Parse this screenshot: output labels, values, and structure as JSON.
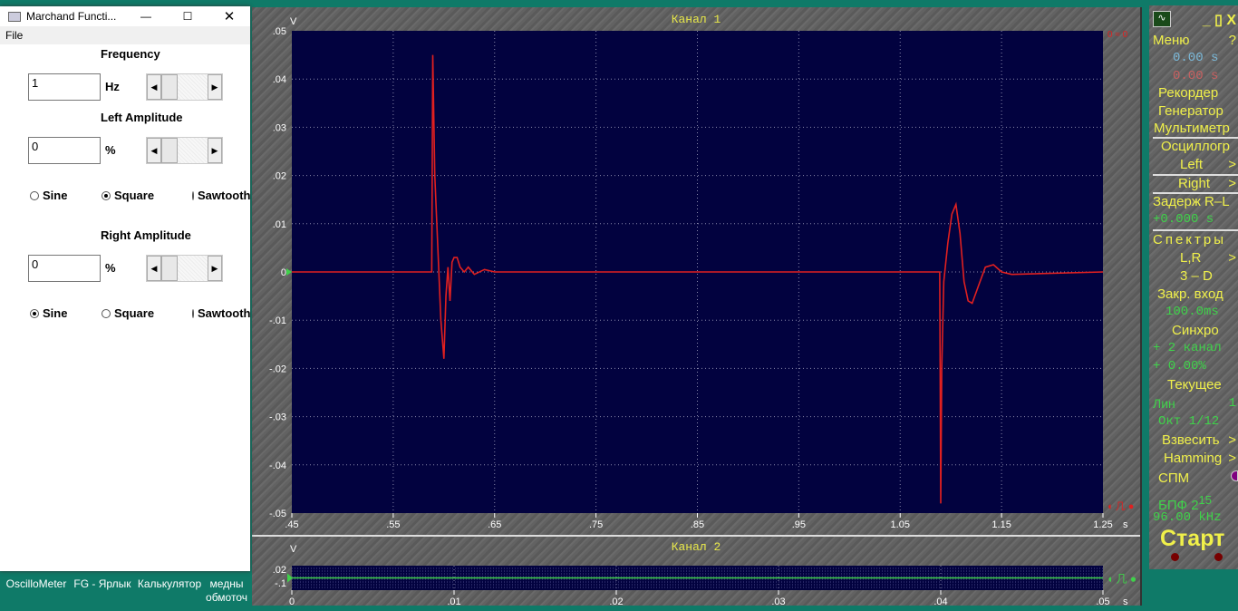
{
  "desktop": {
    "icons": [
      "OscilloMeter",
      "FG - Ярлык",
      "Калькулятор",
      "медны обмоточ"
    ]
  },
  "fg_window": {
    "title": "Marchand Functi...",
    "menu": [
      "File"
    ],
    "frequency": {
      "label": "Frequency",
      "value": "1",
      "unit": "Hz"
    },
    "left": {
      "label": "Left Amplitude",
      "value": "0",
      "unit": "%",
      "waveforms": [
        "Sine",
        "Square",
        "Sawtooth"
      ],
      "selected": "Square"
    },
    "right": {
      "label": "Right Amplitude",
      "value": "0",
      "unit": "%",
      "waveforms": [
        "Sine",
        "Square",
        "Sawtooth"
      ],
      "selected": "Sine"
    }
  },
  "oscilloscope": {
    "channel1": {
      "title": "Канал 1",
      "marker": "0 ≈ 0"
    },
    "channel2": {
      "title": "Канал 2"
    },
    "colors": {
      "plot_bg": "#02023f",
      "trace1": "#e02020",
      "trace2": "#3fd24a"
    }
  },
  "chart_data": [
    {
      "type": "line",
      "title": "Канал 1",
      "ylabel": "V",
      "xlabel": "s",
      "xlim": [
        0.45,
        1.25
      ],
      "ylim": [
        -0.05,
        0.05
      ],
      "grid": true,
      "xticks": [
        ".45",
        ".55",
        ".65",
        ".75",
        ".85",
        ".95",
        "1.05",
        "1.15",
        "1.25"
      ],
      "yticks": [
        ".05",
        ".04",
        ".03",
        ".02",
        ".01",
        "0",
        "-.01",
        "-.02",
        "-.03",
        "-.04",
        "-.05"
      ],
      "series": [
        {
          "color": "#e02020",
          "points": [
            [
              0.45,
              0
            ],
            [
              0.588,
              0
            ],
            [
              0.589,
              0.045
            ],
            [
              0.591,
              0.02
            ],
            [
              0.594,
              0.005
            ],
            [
              0.597,
              -0.01
            ],
            [
              0.6,
              -0.018
            ],
            [
              0.602,
              -0.005
            ],
            [
              0.604,
              0.001
            ],
            [
              0.606,
              -0.006
            ],
            [
              0.608,
              0.002
            ],
            [
              0.61,
              0.003
            ],
            [
              0.613,
              0.003
            ],
            [
              0.616,
              0.001
            ],
            [
              0.62,
              0
            ],
            [
              0.624,
              0.001
            ],
            [
              0.63,
              -0.0005
            ],
            [
              0.64,
              0.0005
            ],
            [
              0.65,
              0
            ],
            [
              1.089,
              0
            ],
            [
              1.09,
              -0.048
            ],
            [
              1.091,
              -0.02
            ],
            [
              1.093,
              -0.002
            ],
            [
              1.097,
              0.006
            ],
            [
              1.101,
              0.012
            ],
            [
              1.105,
              0.014
            ],
            [
              1.109,
              0.008
            ],
            [
              1.113,
              -0.002
            ],
            [
              1.117,
              -0.006
            ],
            [
              1.121,
              -0.0065
            ],
            [
              1.127,
              -0.003
            ],
            [
              1.134,
              0.001
            ],
            [
              1.142,
              0.0015
            ],
            [
              1.15,
              0
            ],
            [
              1.16,
              -0.0005
            ],
            [
              1.25,
              0
            ]
          ]
        }
      ]
    },
    {
      "type": "line",
      "title": "Канал 2",
      "ylabel": "V",
      "xlabel": "s",
      "xlim": [
        0,
        0.05
      ],
      "xticks": [
        "0",
        ".01",
        ".02",
        ".03",
        ".04",
        ".05"
      ],
      "yticks": [
        ".02",
        "-.1"
      ],
      "series": [
        {
          "color": "#3fd24a",
          "points": [
            [
              0,
              0
            ],
            [
              0.05,
              0
            ]
          ]
        }
      ]
    }
  ],
  "right_panel": {
    "menu": "Меню",
    "help": "?",
    "t1": "0.00 s",
    "t2": "0.00 s",
    "recorder": "Рекордер",
    "generator": "Генератор",
    "multimeter": "Мультиметр",
    "osc": "Осциллогр",
    "left": "Left",
    "right": "Right",
    "delay": "Задерж R–L",
    "delay_val": "+0.000 s",
    "spectra": "Спектры",
    "lr": "L,R",
    "3d": "3 – D",
    "closed_in": "Закр. вход",
    "closed_val": "100.0ms",
    "sync": "Синхро",
    "sync_ch": "+ 2 канал",
    "sync_pct": "+ 0.00%",
    "current": "Текущее",
    "lin": "Лин",
    "lin_val": "1",
    "oct": "Окт 1/12",
    "weigh": "Взвесить",
    "hamming": "Hamming",
    "spm": "СПМ",
    "fft": "БПФ 2",
    "fft_exp": "15",
    "rate": "96.00 kHz",
    "start": "Старт",
    "arrow": ">"
  }
}
